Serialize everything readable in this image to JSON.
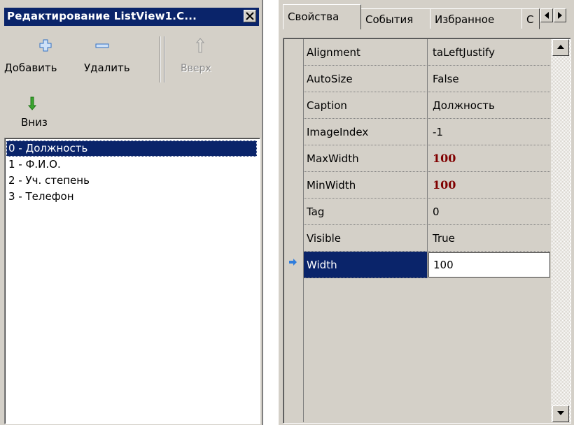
{
  "editor": {
    "title": "Редактирование ListView1.C...",
    "toolbar": {
      "add_label": "Добавить",
      "delete_label": "Удалить",
      "up_label": "Вверх",
      "down_label": "Вниз"
    },
    "columns": [
      "0 - Должность",
      "1 - Ф.И.О.",
      "2 - Уч. степень",
      "3 - Телефон"
    ]
  },
  "inspector": {
    "tabs": [
      "Свойства",
      "События",
      "Избранное",
      "С"
    ],
    "properties": [
      {
        "name": "Alignment",
        "value": "taLeftJustify"
      },
      {
        "name": "AutoSize",
        "value": "False"
      },
      {
        "name": "Caption",
        "value": "Должность"
      },
      {
        "name": "ImageIndex",
        "value": "-1"
      },
      {
        "name": "MaxWidth",
        "value": "100"
      },
      {
        "name": "MinWidth",
        "value": "100"
      },
      {
        "name": "Tag",
        "value": "0"
      },
      {
        "name": "Visible",
        "value": "True"
      },
      {
        "name": "Width",
        "value": "100"
      }
    ]
  },
  "colors": {
    "selection": "#0a246a",
    "face": "#d4d0c8",
    "modified_value": "#800000",
    "up_arrow": "#2f7ddd",
    "down_arrow": "#3aa52f"
  }
}
